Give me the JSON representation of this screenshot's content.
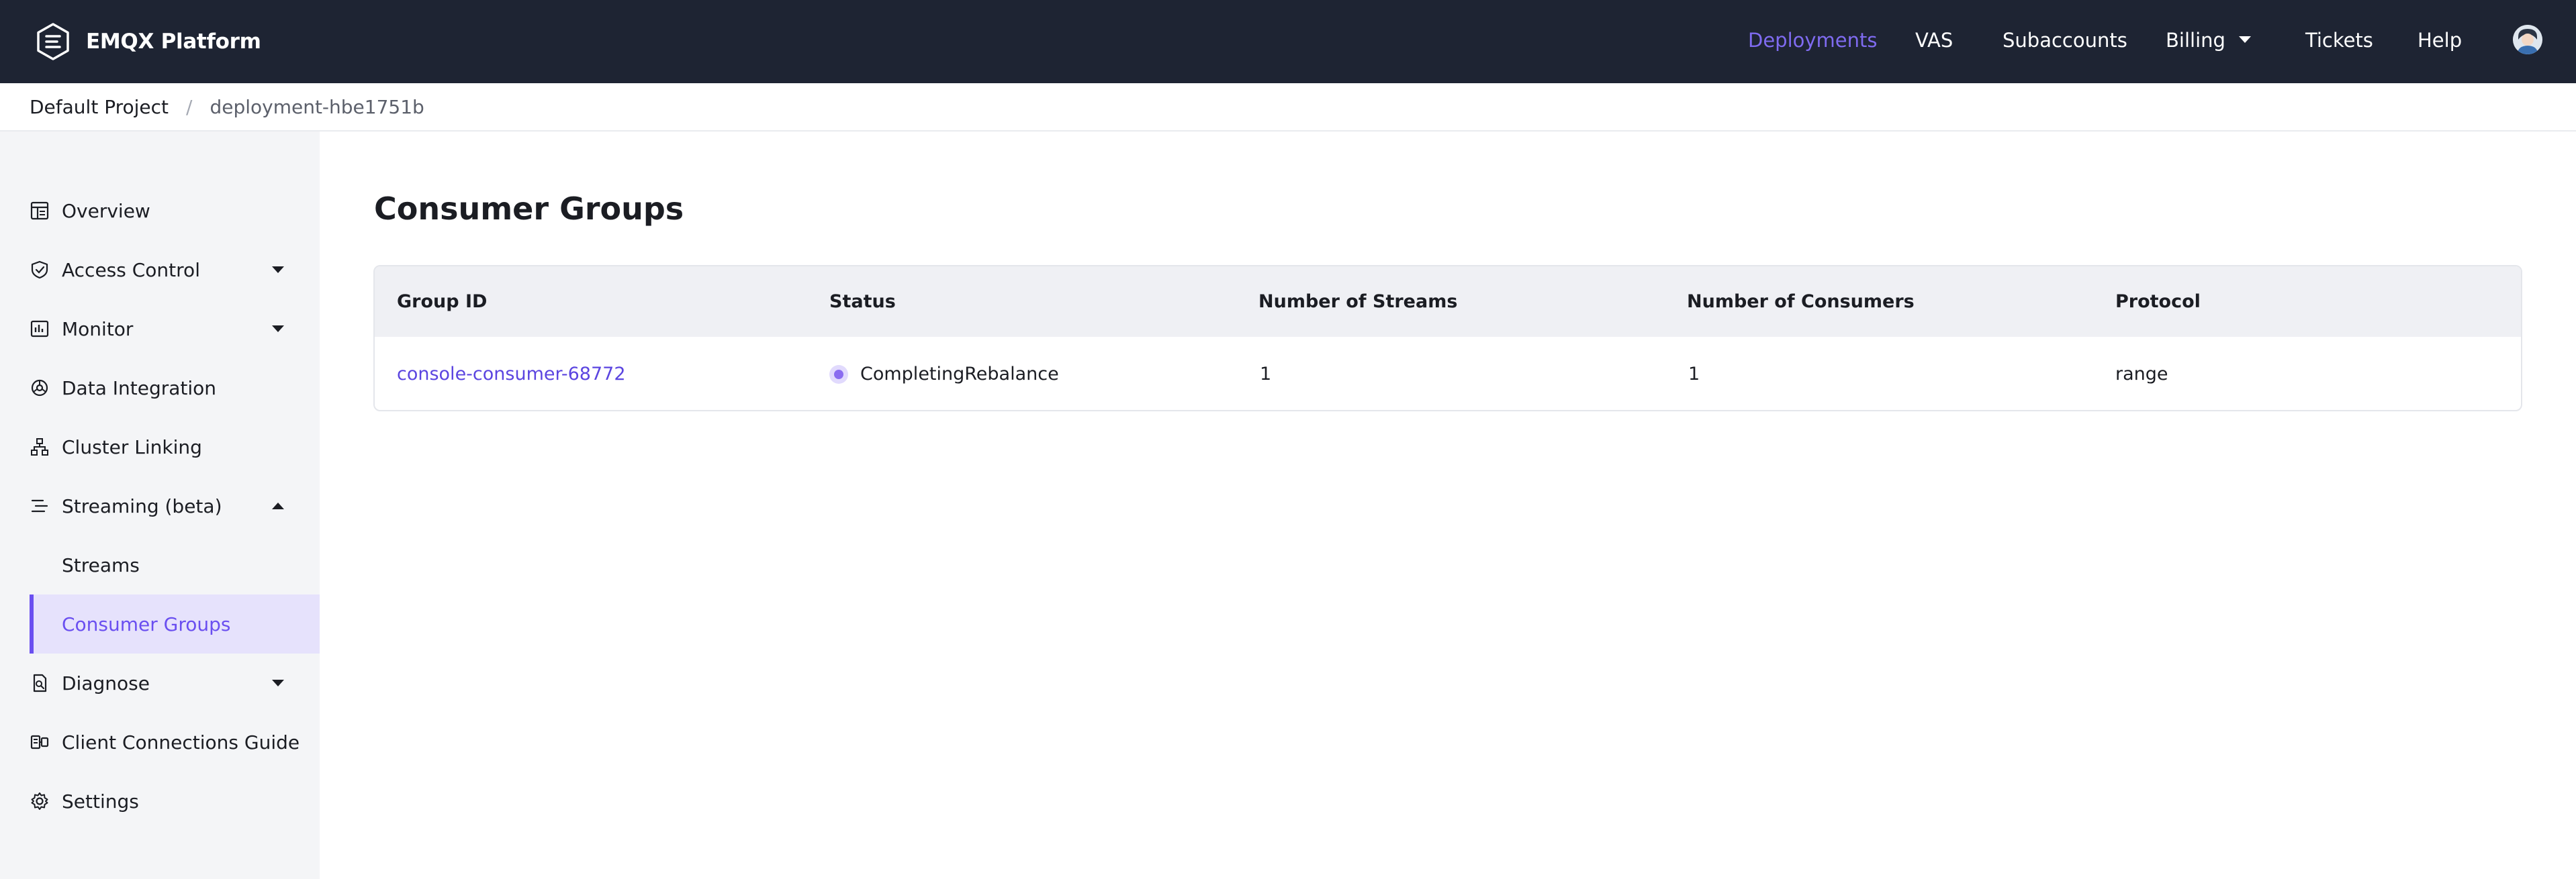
{
  "header": {
    "brand_name": "EMQX Platform",
    "nav": [
      {
        "label": "Deployments",
        "active": true
      },
      {
        "label": "VAS",
        "active": false
      },
      {
        "label": "Subaccounts",
        "active": false
      },
      {
        "label": "Billing",
        "active": false,
        "has_dropdown": true
      },
      {
        "label": "Tickets",
        "active": false
      },
      {
        "label": "Help",
        "active": false
      }
    ],
    "accent_color": "#6a4ff0"
  },
  "breadcrumb": {
    "root": "Default Project",
    "separator": "/",
    "current": "deployment-hbe1751b"
  },
  "sidebar": {
    "items": [
      {
        "label": "Overview",
        "icon": "dashboard-icon"
      },
      {
        "label": "Access Control",
        "icon": "shield-icon",
        "expandable": true,
        "expanded": false
      },
      {
        "label": "Monitor",
        "icon": "chart-icon",
        "expandable": true,
        "expanded": false
      },
      {
        "label": "Data Integration",
        "icon": "integration-icon"
      },
      {
        "label": "Cluster Linking",
        "icon": "network-icon"
      },
      {
        "label": "Streaming (beta)",
        "icon": "streaming-icon",
        "expandable": true,
        "expanded": true
      },
      {
        "label": "Streams",
        "sub": true
      },
      {
        "label": "Consumer Groups",
        "sub": true,
        "selected": true
      },
      {
        "label": "Diagnose",
        "icon": "diagnose-icon",
        "expandable": true,
        "expanded": false
      },
      {
        "label": "Client Connections Guide",
        "icon": "guide-icon"
      },
      {
        "label": "Settings",
        "icon": "gear-icon"
      }
    ]
  },
  "main": {
    "title": "Consumer Groups",
    "table": {
      "columns": [
        "Group ID",
        "Status",
        "Number of Streams",
        "Number of Consumers",
        "Protocol"
      ],
      "rows": [
        {
          "group_id": "console-consumer-68772",
          "status": "CompletingRebalance",
          "streams": "1",
          "consumers": "1",
          "protocol": "range"
        }
      ]
    }
  }
}
